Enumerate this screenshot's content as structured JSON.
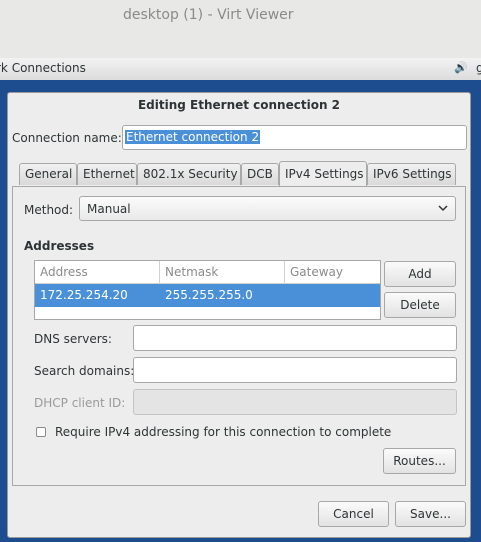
{
  "outer_window": {
    "title": "desktop (1) - Virt Viewer"
  },
  "guest_topbar": {
    "title": "rk Connections",
    "volume_icon": "speaker-icon",
    "overflow_text": "g"
  },
  "dialog": {
    "title": "Editing Ethernet connection 2",
    "connection_name_label": "Connection name:",
    "connection_name_value": "Ethernet connection 2",
    "tabs": [
      "General",
      "Ethernet",
      "802.1x Security",
      "DCB",
      "IPv4 Settings",
      "IPv6 Settings"
    ],
    "active_tab": "IPv4 Settings",
    "ipv4": {
      "method_label": "Method:",
      "method_value": "Manual",
      "addresses_heading": "Addresses",
      "columns": [
        "Address",
        "Netmask",
        "Gateway"
      ],
      "rows": [
        {
          "address": "172.25.254.20",
          "netmask": "255.255.255.0",
          "gateway": ""
        }
      ],
      "add_label": "Add",
      "delete_label": "Delete",
      "dns_label": "DNS servers:",
      "dns_value": "",
      "search_label": "Search domains:",
      "search_value": "",
      "dhcp_label": "DHCP client ID:",
      "dhcp_value": "",
      "require_label": "Require IPv4 addressing for this connection to complete",
      "require_checked": false,
      "routes_label": "Routes..."
    },
    "cancel_label": "Cancel",
    "save_label": "Save..."
  }
}
